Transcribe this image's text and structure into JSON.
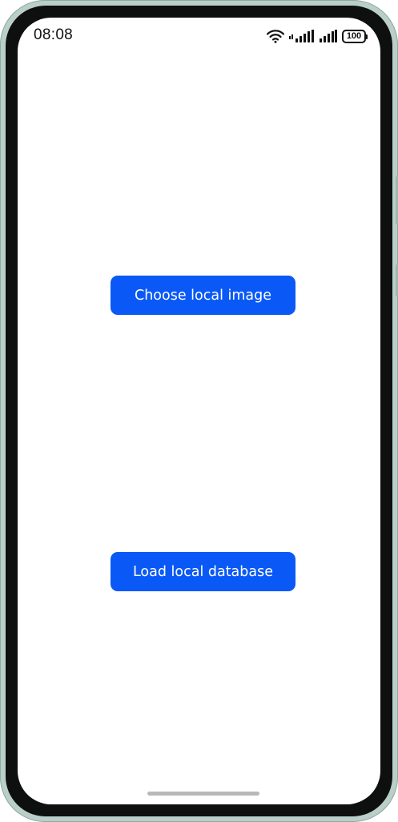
{
  "status_bar": {
    "time": "08:08",
    "battery_level": "100",
    "icons": [
      "wifi-icon",
      "mobile-signal-icon",
      "signal-icon",
      "battery-icon"
    ]
  },
  "main": {
    "choose_image_label": "Choose local image",
    "load_database_label": "Load local database"
  },
  "colors": {
    "button_background": "#0a59f7",
    "button_text": "#ffffff",
    "frame": "#b9cfc7",
    "home_indicator": "#b8b8b8"
  }
}
